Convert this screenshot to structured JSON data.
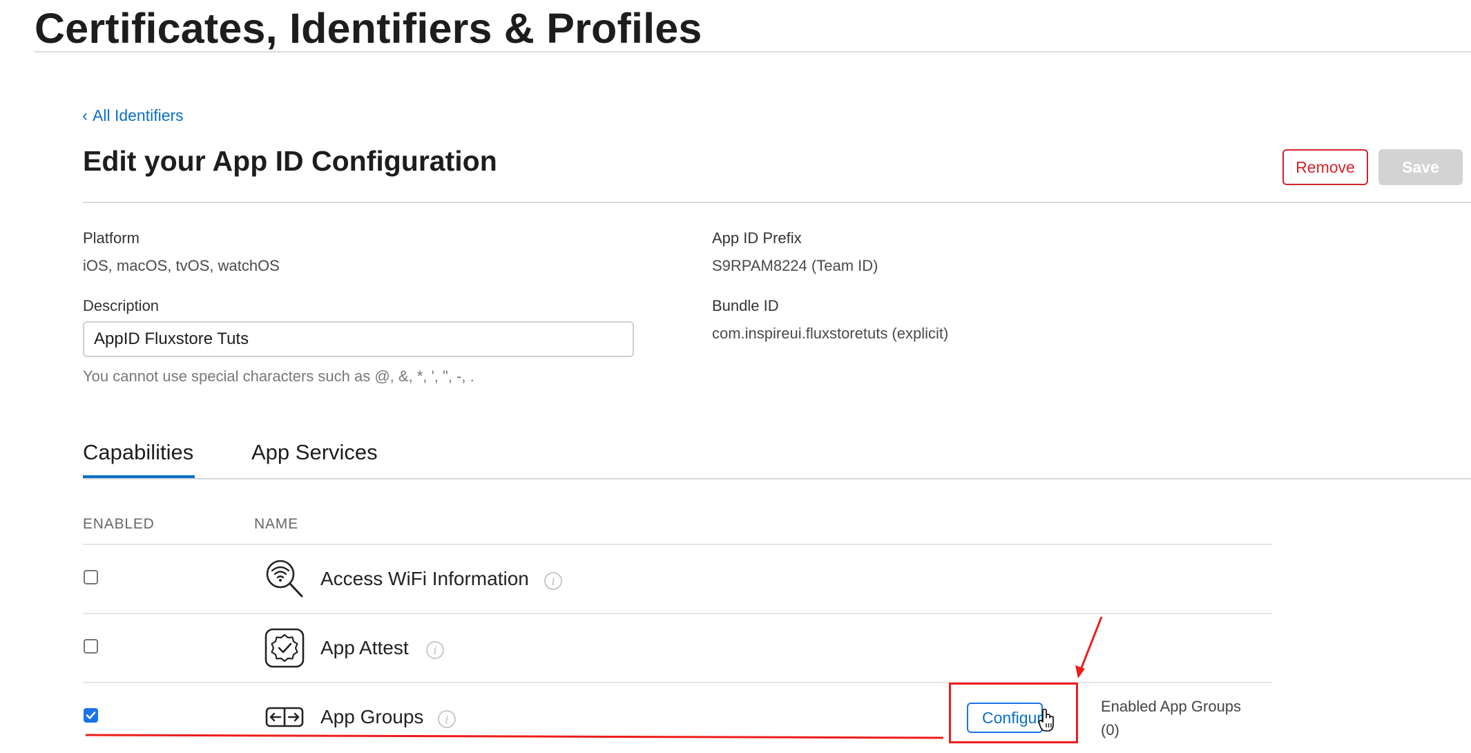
{
  "page": {
    "title": "Certificates, Identifiers & Profiles"
  },
  "nav": {
    "back_label": "All Identifiers"
  },
  "section": {
    "title": "Edit your App ID Configuration",
    "remove_label": "Remove",
    "save_label": "Save"
  },
  "fields": {
    "platform_label": "Platform",
    "platform_value": "iOS, macOS, tvOS, watchOS",
    "prefix_label": "App ID Prefix",
    "prefix_value": "S9RPAM8224 (Team ID)",
    "description_label": "Description",
    "description_value": "AppID Fluxstore Tuts",
    "description_help": "You cannot use special characters such as @, &, *, ', \", -, .",
    "bundle_label": "Bundle ID",
    "bundle_value": "com.inspireui.fluxstoretuts (explicit)"
  },
  "tabs": [
    {
      "label": "Capabilities",
      "active": true
    },
    {
      "label": "App Services",
      "active": false
    }
  ],
  "table": {
    "columns": [
      "ENABLED",
      "NAME"
    ],
    "rows": [
      {
        "name": "Access WiFi Information",
        "enabled": false,
        "icon": "wifi-search-icon"
      },
      {
        "name": "App Attest",
        "enabled": false,
        "icon": "verified-badge-icon"
      },
      {
        "name": "App Groups",
        "enabled": true,
        "icon": "app-groups-icon",
        "configure_label": "Configure",
        "enabled_groups_label": "Enabled App Groups",
        "enabled_groups_count": "(0)"
      }
    ]
  },
  "annotations": {
    "color": "#ee1c1c"
  },
  "colors": {
    "accent": "#0a6fc5",
    "danger": "#d2232a",
    "disabled": "#d3d3d3"
  }
}
